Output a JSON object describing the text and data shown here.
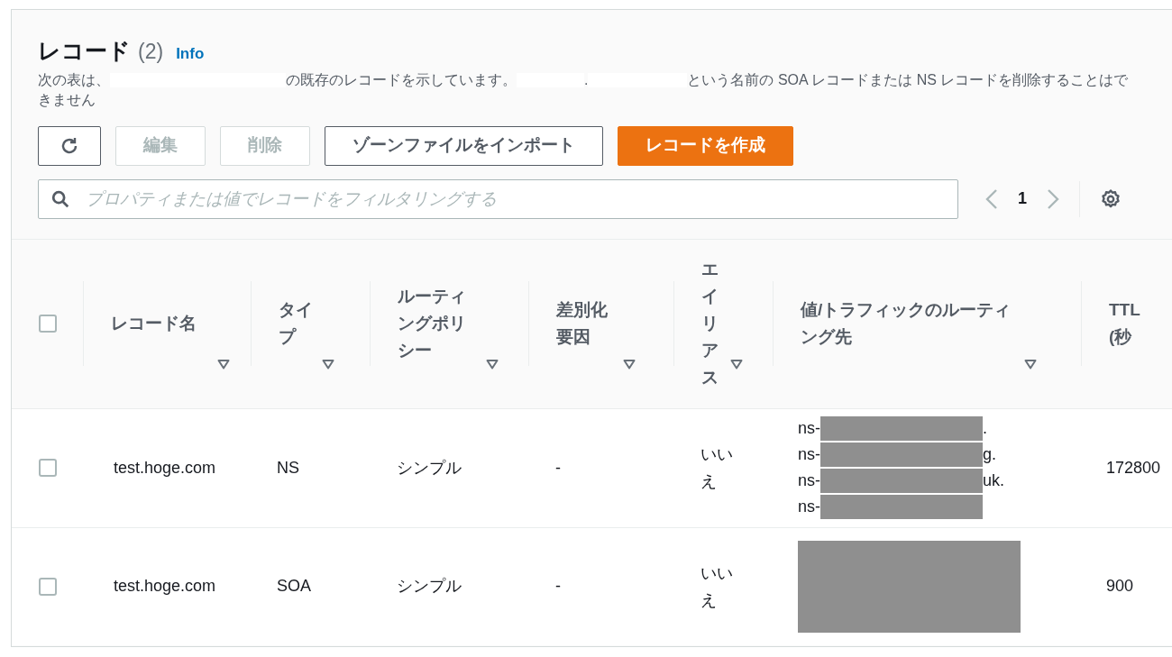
{
  "header": {
    "title": "レコード",
    "count": "(2)",
    "info_link": "Info"
  },
  "description": [
    {
      "kind": "text",
      "text": "次の表は、"
    },
    {
      "kind": "redacted"
    },
    {
      "kind": "text",
      "text": "の既存のレコードを示しています。"
    },
    {
      "kind": "redacted"
    },
    {
      "kind": "text",
      "text": "."
    },
    {
      "kind": "redacted"
    },
    {
      "kind": "text",
      "text": "という名前の SOA レコードまたは NS レコードを削除することはできません"
    }
  ],
  "actions": [
    {
      "kind": "refresh",
      "disabled": false
    },
    {
      "kind": "normal",
      "label": "編集",
      "disabled": true
    },
    {
      "kind": "normal",
      "label": "削除",
      "disabled": true
    },
    {
      "kind": "normal",
      "label": "ゾーンファイルをインポート",
      "disabled": false
    },
    {
      "kind": "primary",
      "label": "レコードを作成",
      "disabled": false
    }
  ],
  "filter": {
    "placeholder": "プロパティまたは値でレコードをフィルタリングする"
  },
  "pagination": {
    "page": "1",
    "prev_disabled": true,
    "next_disabled": true
  },
  "table": {
    "select_all": {
      "checked": false
    },
    "columns": [
      {
        "label": "レコード名",
        "sortable": true
      },
      {
        "label": "タイプ",
        "sortable": true
      },
      {
        "label": "ルーティングポリシー",
        "sortable": true
      },
      {
        "label": "差別化要因",
        "sortable": true
      },
      {
        "label": "エイリアス",
        "sortable": true
      },
      {
        "label": "値/トラフィックのルーティング先",
        "sortable": true
      },
      {
        "label": "TTL (秒",
        "sortable": false
      }
    ],
    "rows": [
      {
        "checked": false,
        "name": "test.hoge.com",
        "type": "NS",
        "routing": "シンプル",
        "differentiator": "-",
        "alias": "いいえ",
        "value_lines": [
          {
            "prefix": "ns-",
            "suffix": "."
          },
          {
            "prefix": "ns-",
            "suffix": "g."
          },
          {
            "prefix": "ns-",
            "suffix": "uk."
          },
          {
            "prefix": "ns-"
          }
        ],
        "ttl": "172800"
      },
      {
        "checked": false,
        "name": "test.hoge.com",
        "type": "SOA",
        "routing": "シンプル",
        "differentiator": "-",
        "alias": "いいえ",
        "ttl": "900"
      }
    ]
  }
}
